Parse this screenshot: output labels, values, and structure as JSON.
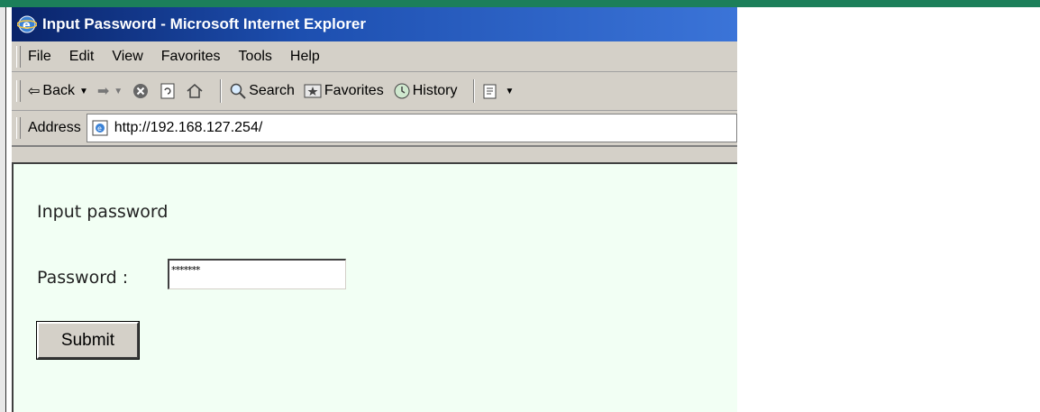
{
  "window": {
    "title": "Input Password - Microsoft Internet Explorer"
  },
  "menu": [
    "File",
    "Edit",
    "View",
    "Favorites",
    "Tools",
    "Help"
  ],
  "toolbar": {
    "back_label": "Back",
    "search_label": "Search",
    "favorites_label": "Favorites",
    "history_label": "History"
  },
  "address": {
    "label": "Address",
    "url": "http://192.168.127.254/"
  },
  "page": {
    "heading": "Input password",
    "password_label": "Password :",
    "password_value": "*******",
    "submit_label": "Submit"
  },
  "colors": {
    "background": "#f2fff4",
    "titlebar": "#0a246a",
    "accent_bar": "#1c7f5a"
  }
}
